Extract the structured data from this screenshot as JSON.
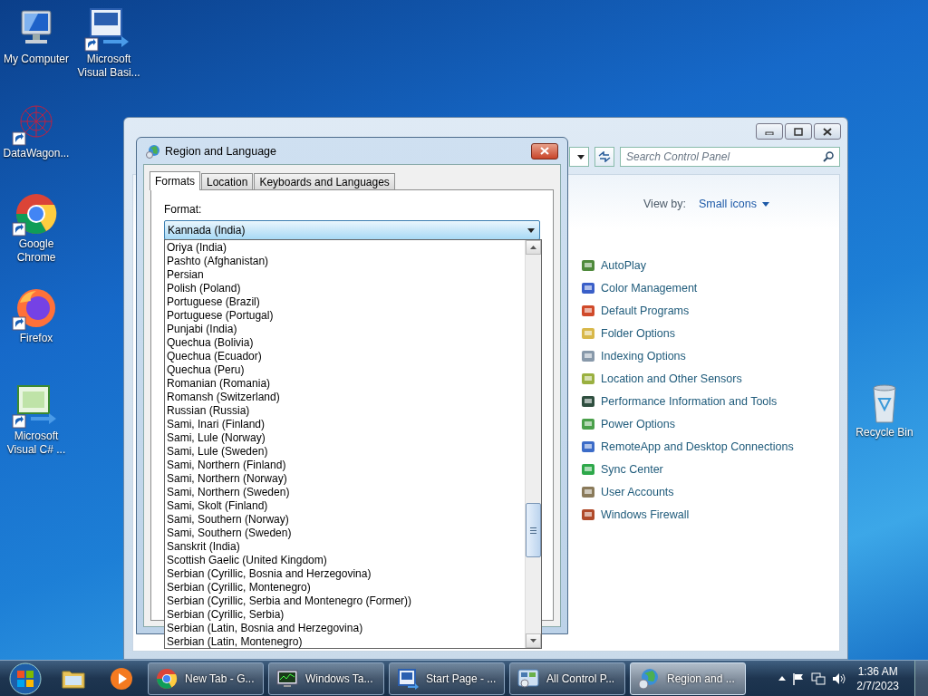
{
  "desktop_icons": [
    {
      "label": "My Computer",
      "kind": "computer"
    },
    {
      "label": "Microsoft Visual Basi...",
      "kind": "vb"
    },
    {
      "label": "DataWagon...",
      "kind": "datawagon"
    },
    {
      "label": "Google Chrome",
      "kind": "chrome"
    },
    {
      "label": "Firefox",
      "kind": "firefox"
    },
    {
      "label": "Microsoft Visual C# ...",
      "kind": "csharp"
    },
    {
      "label": "Recycle Bin",
      "kind": "recycle"
    }
  ],
  "control_panel": {
    "search": {
      "placeholder": "Search Control Panel"
    },
    "view_by_label": "View by:",
    "view_by_value": "Small icons",
    "items": [
      {
        "label": "AutoPlay",
        "kind": "autoplay"
      },
      {
        "label": "Color Management",
        "kind": "color"
      },
      {
        "label": "Default Programs",
        "kind": "defaults"
      },
      {
        "label": "Folder Options",
        "kind": "folder"
      },
      {
        "label": "Indexing Options",
        "kind": "indexing"
      },
      {
        "label": "Location and Other Sensors",
        "kind": "location"
      },
      {
        "label": "Performance Information and Tools",
        "kind": "performance"
      },
      {
        "label": "Power Options",
        "kind": "power"
      },
      {
        "label": "RemoteApp and Desktop Connections",
        "kind": "remote"
      },
      {
        "label": "Sync Center",
        "kind": "sync"
      },
      {
        "label": "User Accounts",
        "kind": "users"
      },
      {
        "label": "Windows Firewall",
        "kind": "firewall"
      }
    ]
  },
  "dialog": {
    "title": "Region and Language",
    "tabs": [
      {
        "label": "Formats",
        "selected": true
      },
      {
        "label": "Location",
        "selected": false
      },
      {
        "label": "Keyboards and Languages",
        "selected": false
      }
    ],
    "format_label": "Format:",
    "format_value": "Kannada (India)",
    "options": [
      {
        "label": "Oriya (India)",
        "selected": false
      },
      {
        "label": "Pashto (Afghanistan)",
        "selected": false
      },
      {
        "label": "Persian",
        "selected": false
      },
      {
        "label": "Polish (Poland)",
        "selected": false
      },
      {
        "label": "Portuguese (Brazil)",
        "selected": false
      },
      {
        "label": "Portuguese (Portugal)",
        "selected": false
      },
      {
        "label": "Punjabi (India)",
        "selected": false
      },
      {
        "label": "Quechua (Bolivia)",
        "selected": false
      },
      {
        "label": "Quechua (Ecuador)",
        "selected": false
      },
      {
        "label": "Quechua (Peru)",
        "selected": false
      },
      {
        "label": "Romanian (Romania)",
        "selected": false
      },
      {
        "label": "Romansh (Switzerland)",
        "selected": false
      },
      {
        "label": "Russian (Russia)",
        "selected": false
      },
      {
        "label": "Sami, Inari (Finland)",
        "selected": false
      },
      {
        "label": "Sami, Lule (Norway)",
        "selected": false
      },
      {
        "label": "Sami, Lule (Sweden)",
        "selected": false
      },
      {
        "label": "Sami, Northern (Finland)",
        "selected": false
      },
      {
        "label": "Sami, Northern (Norway)",
        "selected": false
      },
      {
        "label": "Sami, Northern (Sweden)",
        "selected": false
      },
      {
        "label": "Sami, Skolt (Finland)",
        "selected": false
      },
      {
        "label": "Sami, Southern (Norway)",
        "selected": false
      },
      {
        "label": "Sami, Southern (Sweden)",
        "selected": false
      },
      {
        "label": "Sanskrit (India)",
        "selected": false
      },
      {
        "label": "Scottish Gaelic (United Kingdom)",
        "selected": false
      },
      {
        "label": "Serbian (Cyrillic, Bosnia and Herzegovina)",
        "selected": false
      },
      {
        "label": "Serbian (Cyrillic, Montenegro)",
        "selected": false
      },
      {
        "label": "Serbian (Cyrillic, Serbia and Montenegro (Former))",
        "selected": false
      },
      {
        "label": "Serbian (Cyrillic, Serbia)",
        "selected": false
      },
      {
        "label": "Serbian (Latin, Bosnia and Herzegovina)",
        "selected": false
      },
      {
        "label": "Serbian (Latin, Montenegro)",
        "selected": false
      }
    ]
  },
  "taskbar": {
    "pinned": [
      {
        "kind": "folder"
      },
      {
        "kind": "media"
      }
    ],
    "buttons": [
      {
        "label": "New Tab - G...",
        "kind": "chrome",
        "selected": false
      },
      {
        "label": "Windows Ta...",
        "kind": "monitor",
        "selected": false
      },
      {
        "label": "Start Page - ...",
        "kind": "vb",
        "selected": false
      },
      {
        "label": "All Control P...",
        "kind": "panel",
        "selected": false
      },
      {
        "label": "Region and ...",
        "kind": "globe",
        "selected": true
      }
    ],
    "time": "1:36 AM",
    "date": "2/7/2023"
  }
}
